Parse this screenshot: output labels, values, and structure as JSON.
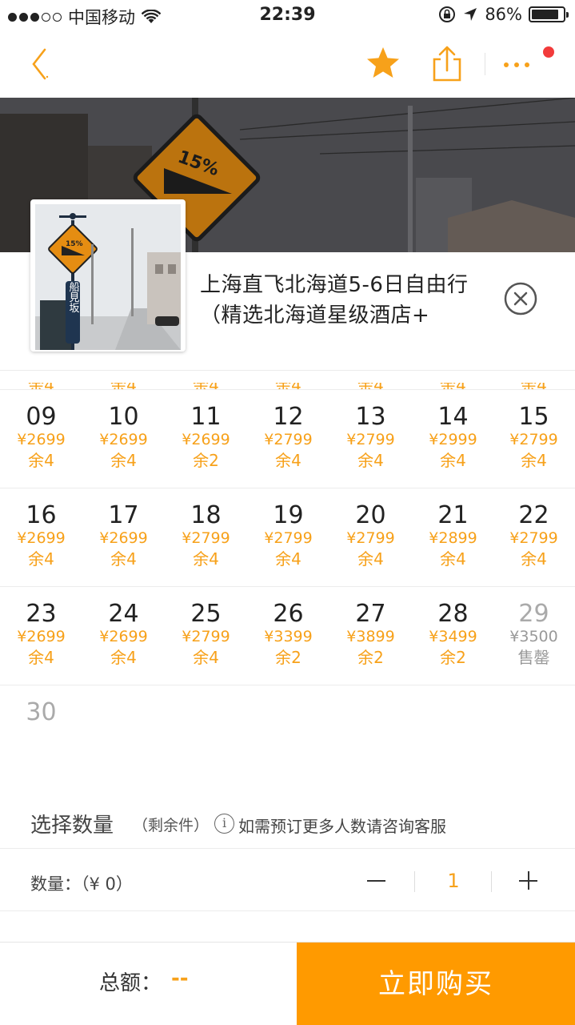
{
  "status_bar": {
    "carrier": "中国移动",
    "time": "22:39",
    "battery": "86%",
    "battery_level": 0.86
  },
  "nav": {
    "back_icon": "chevron-left-icon",
    "favorite_icon": "star-icon",
    "share_icon": "share-icon",
    "more_icon": "more-dots-icon",
    "accent_color": "#f7a11a"
  },
  "product": {
    "title": "上海直飞北海道5-6日自由行（精选北海道星级酒店+",
    "thumbnail_sign_text": "15%",
    "thumbnail_post_text": "船見坂",
    "banner_sign_text": "15%"
  },
  "calendar": {
    "weeks": [
      [
        {
          "day": "09",
          "price": "¥2699",
          "stock": "余4",
          "sold_out": false
        },
        {
          "day": "10",
          "price": "¥2699",
          "stock": "余4",
          "sold_out": false
        },
        {
          "day": "11",
          "price": "¥2699",
          "stock": "余2",
          "sold_out": false
        },
        {
          "day": "12",
          "price": "¥2799",
          "stock": "余4",
          "sold_out": false
        },
        {
          "day": "13",
          "price": "¥2799",
          "stock": "余4",
          "sold_out": false
        },
        {
          "day": "14",
          "price": "¥2999",
          "stock": "余4",
          "sold_out": false
        },
        {
          "day": "15",
          "price": "¥2799",
          "stock": "余4",
          "sold_out": false
        }
      ],
      [
        {
          "day": "16",
          "price": "¥2699",
          "stock": "余4",
          "sold_out": false
        },
        {
          "day": "17",
          "price": "¥2699",
          "stock": "余4",
          "sold_out": false
        },
        {
          "day": "18",
          "price": "¥2799",
          "stock": "余4",
          "sold_out": false
        },
        {
          "day": "19",
          "price": "¥2799",
          "stock": "余4",
          "sold_out": false
        },
        {
          "day": "20",
          "price": "¥2799",
          "stock": "余4",
          "sold_out": false
        },
        {
          "day": "21",
          "price": "¥2899",
          "stock": "余4",
          "sold_out": false
        },
        {
          "day": "22",
          "price": "¥2799",
          "stock": "余4",
          "sold_out": false
        }
      ],
      [
        {
          "day": "23",
          "price": "¥2699",
          "stock": "余4",
          "sold_out": false
        },
        {
          "day": "24",
          "price": "¥2699",
          "stock": "余4",
          "sold_out": false
        },
        {
          "day": "25",
          "price": "¥2799",
          "stock": "余4",
          "sold_out": false
        },
        {
          "day": "26",
          "price": "¥3399",
          "stock": "余2",
          "sold_out": false
        },
        {
          "day": "27",
          "price": "¥3899",
          "stock": "余2",
          "sold_out": false
        },
        {
          "day": "28",
          "price": "¥3499",
          "stock": "余2",
          "sold_out": false
        },
        {
          "day": "29",
          "price": "¥3500",
          "stock": "售罄",
          "sold_out": true
        }
      ],
      [
        {
          "day": "30",
          "price": "",
          "stock": "",
          "sold_out": true
        }
      ]
    ]
  },
  "quantity": {
    "heading": "选择数量",
    "remaining_label": "（剩余件）",
    "info_icon": "info-icon",
    "info_glyph": "i",
    "note": "如需预订更多人数请咨询客服",
    "row_label": "数量：",
    "row_price": "（¥ 0）",
    "value": "1"
  },
  "footer": {
    "total_label": "总额：",
    "total_value": "--",
    "buy_label": "立即购买",
    "buy_color": "#ff9a00"
  }
}
